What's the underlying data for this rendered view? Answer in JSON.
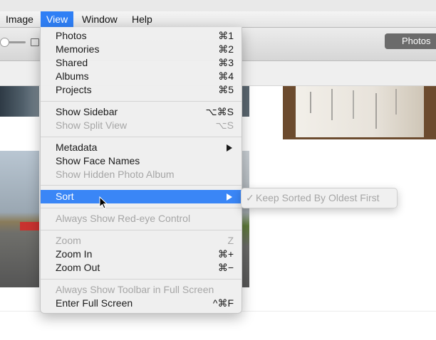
{
  "menubar": {
    "items": [
      {
        "label": "Image",
        "active": false
      },
      {
        "label": "View",
        "active": true
      },
      {
        "label": "Window",
        "active": false
      },
      {
        "label": "Help",
        "active": false
      }
    ]
  },
  "toolbar": {
    "photos_button": "Photos"
  },
  "view_menu": {
    "items": [
      {
        "label": "Photos",
        "shortcut": "⌘1"
      },
      {
        "label": "Memories",
        "shortcut": "⌘2"
      },
      {
        "label": "Shared",
        "shortcut": "⌘3"
      },
      {
        "label": "Albums",
        "shortcut": "⌘4"
      },
      {
        "label": "Projects",
        "shortcut": "⌘5"
      },
      {
        "label": "Show Sidebar",
        "shortcut": "⌥⌘S"
      },
      {
        "label": "Show Split View",
        "shortcut": "⌥S",
        "disabled": true
      },
      {
        "label": "Metadata",
        "submenu": true
      },
      {
        "label": "Show Face Names"
      },
      {
        "label": "Show Hidden Photo Album",
        "disabled": true
      },
      {
        "label": "Sort",
        "submenu": true,
        "highlighted": true
      },
      {
        "label": "Always Show Red-eye Control",
        "disabled": true
      },
      {
        "label": "Zoom",
        "shortcut": "Z",
        "disabled": true
      },
      {
        "label": "Zoom In",
        "shortcut": "⌘+"
      },
      {
        "label": "Zoom Out",
        "shortcut": "⌘−"
      },
      {
        "label": "Always Show Toolbar in Full Screen",
        "disabled": true
      },
      {
        "label": "Enter Full Screen",
        "shortcut": "^⌘F"
      }
    ]
  },
  "sort_submenu": {
    "check": "✓",
    "label": "Keep Sorted By Oldest First",
    "disabled": true
  },
  "colors": {
    "accent": "#3a86f6",
    "menubar_active": "#2f7ff5",
    "disabled_text": "#a6a6a6"
  }
}
